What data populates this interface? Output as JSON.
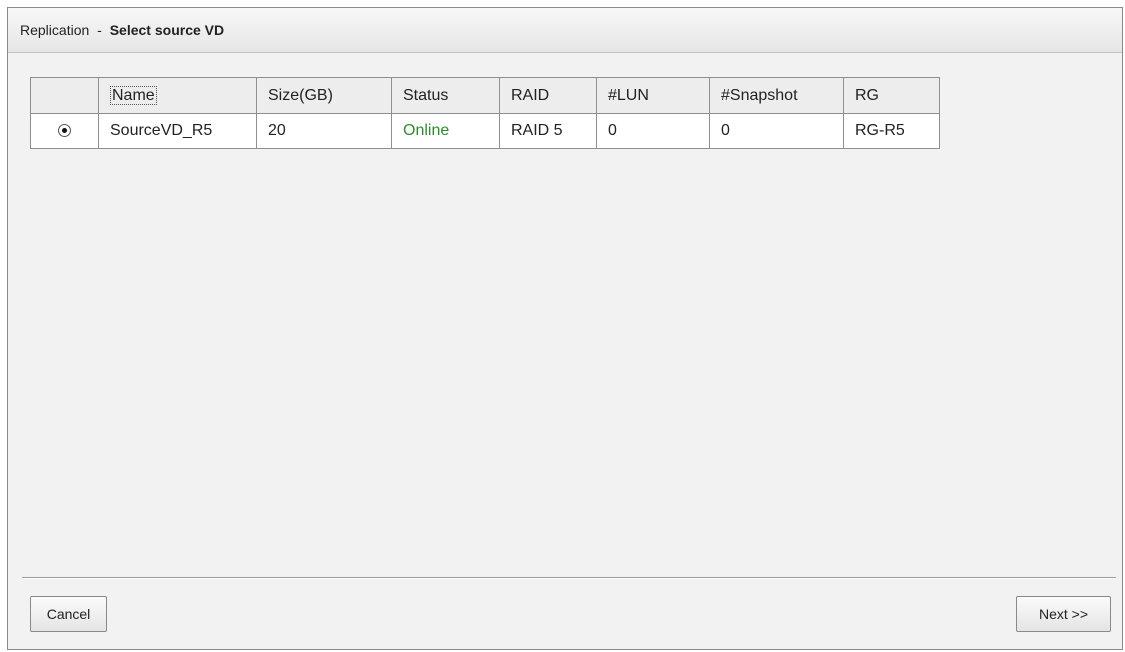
{
  "title": {
    "main": "Replication",
    "separator": "-",
    "sub": "Select source VD"
  },
  "table": {
    "columns": [
      "Name",
      "Size(GB)",
      "Status",
      "RAID",
      "#LUN",
      "#Snapshot",
      "RG"
    ],
    "rows": [
      {
        "selected": true,
        "name": "SourceVD_R5",
        "size": "20",
        "status": "Online",
        "raid": "RAID 5",
        "lun": "0",
        "snapshot": "0",
        "rg": "RG-R5"
      }
    ]
  },
  "buttons": {
    "cancel": "Cancel",
    "next": "Next >>"
  },
  "colors": {
    "status_online": "#2e8b2e"
  }
}
